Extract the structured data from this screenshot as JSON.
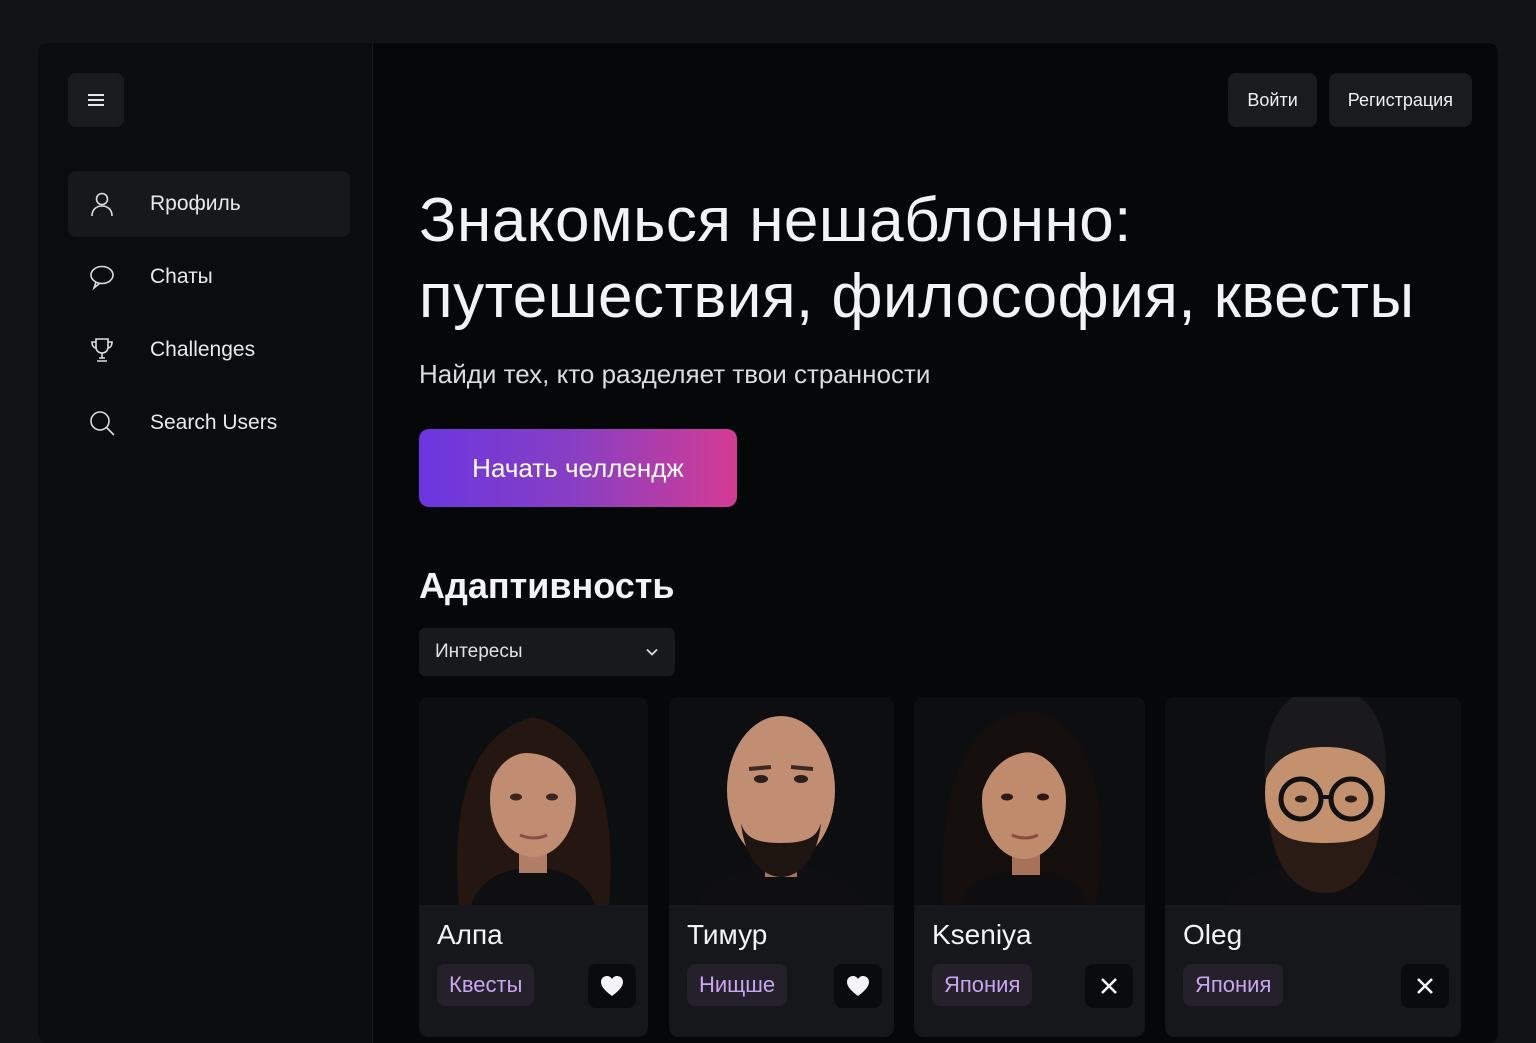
{
  "sidebar": {
    "menu_icon": "hamburger-icon",
    "items": [
      {
        "label": "Rрофиль",
        "icon": "user-icon",
        "active": true
      },
      {
        "label": "Сhаты",
        "icon": "chat-bubble-icon",
        "active": false
      },
      {
        "label": "Challenges",
        "icon": "trophy-icon",
        "active": false
      },
      {
        "label": "Search Users",
        "icon": "search-icon",
        "active": false
      }
    ]
  },
  "header": {
    "login_label": "Войти",
    "register_label": "Регистрация"
  },
  "hero": {
    "title_line1": "Знакомься нешаблонно:",
    "title_line2": "путешествия, философия, квесты",
    "subtitle": "Найди тех, кто разделяет твои странности",
    "cta_label": "Начать челлендж",
    "cta_gradient": [
      "#6a36e0",
      "#d43b93"
    ]
  },
  "section": {
    "title": "Адаптивность",
    "filter": {
      "value": "Интересы",
      "icon": "chevron-down-icon"
    }
  },
  "cards": [
    {
      "name": "Алпа",
      "tag": "Квесты",
      "action_icon": "heart-icon"
    },
    {
      "name": "Тимур",
      "tag": "Нищше",
      "action_icon": "heart-icon"
    },
    {
      "name": "Kseniya",
      "tag": "Япония",
      "action_icon": "close-icon"
    },
    {
      "name": "Oleg",
      "tag": "Япония",
      "action_icon": "close-icon"
    }
  ],
  "colors": {
    "background": "#050708",
    "sidebar": "#0b0c0e",
    "tag_text": "#c9a6f0"
  }
}
